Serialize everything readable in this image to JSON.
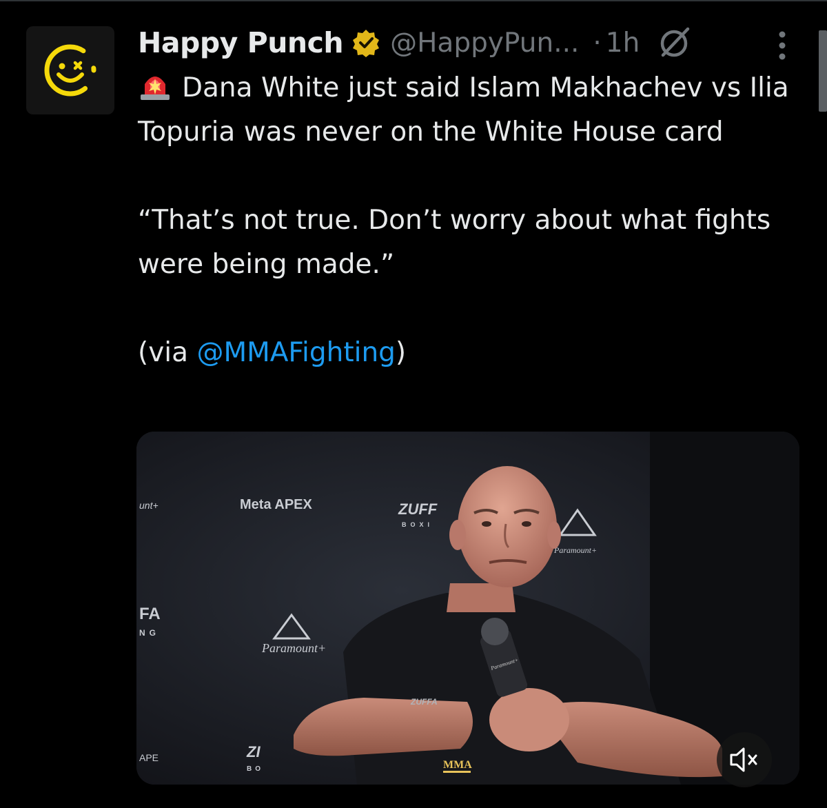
{
  "tweet": {
    "author": {
      "display_name": "Happy Punch",
      "handle": "@HappyPun...",
      "verified": true,
      "avatar_icon": "smiley-face-icon"
    },
    "separator": "·",
    "time": "1h",
    "text": {
      "line1_emoji": "rotating-light-emoji",
      "headline": "Dana White just said Islam Makhachev vs Ilia Topuria was never on the White House card",
      "quote": "“That’s not true. Don’t worry about what fights were being made.”",
      "via_prefix": "(via ",
      "via_mention": "@MMAFighting",
      "via_suffix": ")"
    },
    "media": {
      "type": "video",
      "backdrop_labels": [
        "Meta APEX",
        "Paramount+",
        "ZUFFA BOXING",
        "MMA FIGHTING"
      ],
      "muted": true
    }
  },
  "colors": {
    "background": "#000000",
    "primary_text": "#e7e9ea",
    "secondary_text": "#71767b",
    "link": "#1d9bf0",
    "verified_badge": "#e2b719",
    "avatar_accent": "#f5d90a"
  },
  "icons": [
    "smiley-face-icon",
    "verified-badge-icon",
    "grok-icon",
    "more-options-icon",
    "speaker-muted-icon"
  ]
}
